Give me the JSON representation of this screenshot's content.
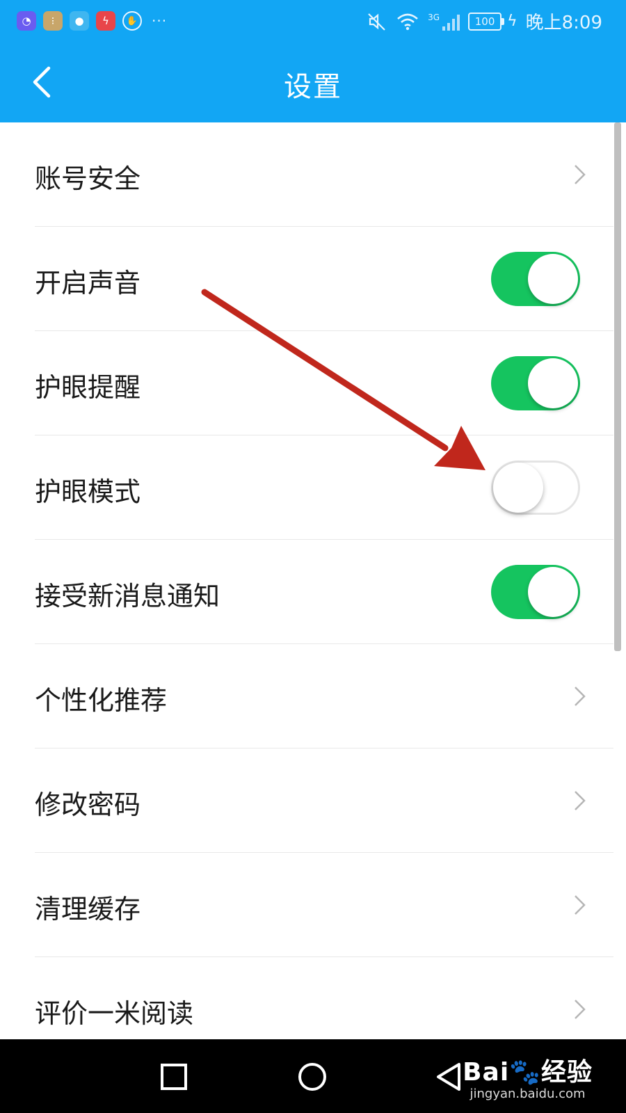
{
  "status_bar": {
    "apps": [
      {
        "icon": "chart-app-icon",
        "color": "#6a5cf0",
        "glyph": "◔"
      },
      {
        "icon": "folder-app-icon",
        "color": "#c8a66a",
        "glyph": "⁝"
      },
      {
        "icon": "chat-bubble-icon",
        "color": "#3fb6f0",
        "glyph": "●"
      },
      {
        "icon": "flash-app-icon",
        "color": "#e8454a",
        "glyph": "ϟ"
      },
      {
        "icon": "hand-shield-icon",
        "color": "#12a6f4",
        "glyph": "✋"
      }
    ],
    "more": "···",
    "network": "3G",
    "battery": "100",
    "time": "晚上8:09"
  },
  "header": {
    "title": "设置"
  },
  "settings": [
    {
      "label": "账号安全",
      "type": "link"
    },
    {
      "label": "开启声音",
      "type": "toggle",
      "state": "on"
    },
    {
      "label": "护眼提醒",
      "type": "toggle",
      "state": "on"
    },
    {
      "label": "护眼模式",
      "type": "toggle",
      "state": "off"
    },
    {
      "label": "接受新消息通知",
      "type": "toggle",
      "state": "on"
    },
    {
      "label": "个性化推荐",
      "type": "link"
    },
    {
      "label": "修改密码",
      "type": "link"
    },
    {
      "label": "清理缓存",
      "type": "link"
    },
    {
      "label": "评价一米阅读",
      "type": "link"
    }
  ],
  "colors": {
    "primary": "#12a6f4",
    "toggle_on": "#15c45f",
    "annotation_arrow": "#c0271c"
  },
  "watermark": {
    "logo": "Bai🐾经验",
    "url": "jingyan.baidu.com"
  }
}
